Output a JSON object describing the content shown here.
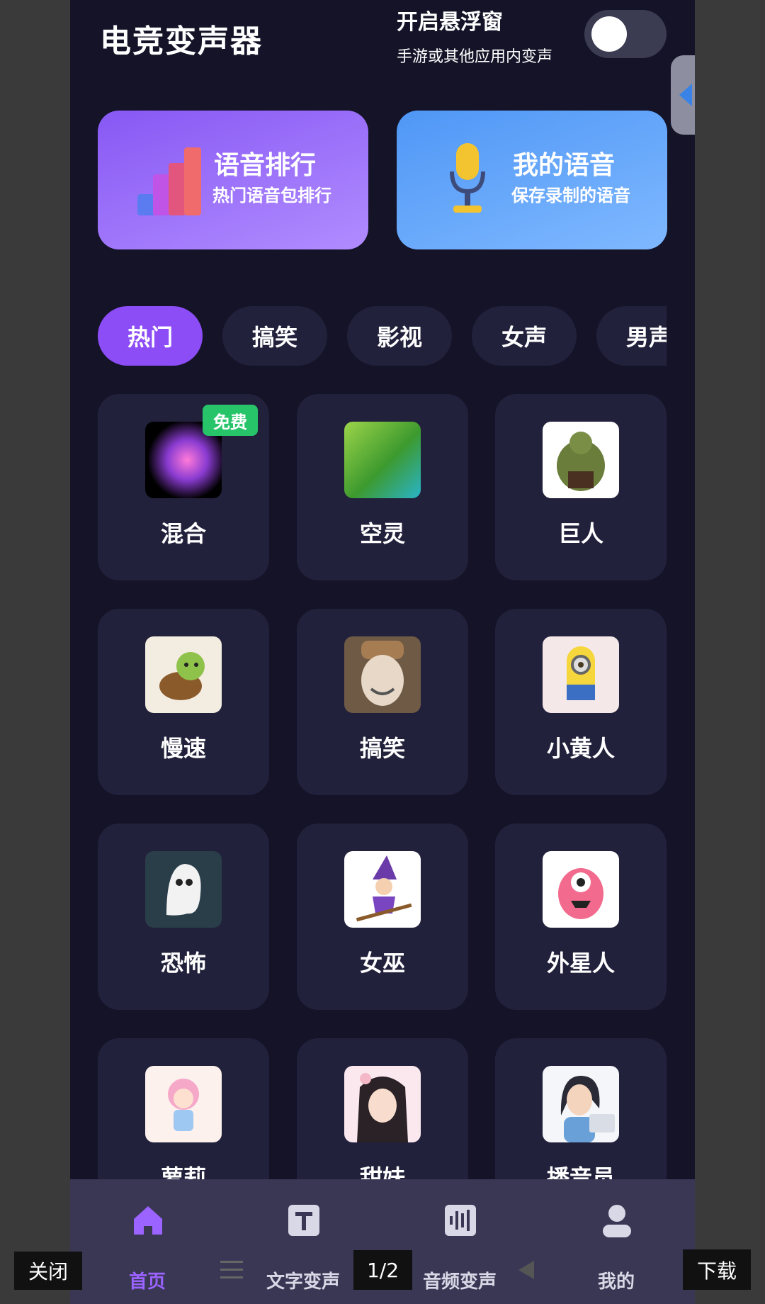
{
  "app": {
    "title": "电竞变声器"
  },
  "float_window": {
    "title": "开启悬浮窗",
    "subtitle": "手游或其他应用内变声",
    "enabled": false
  },
  "cards": [
    {
      "title": "语音排行",
      "subtitle": "热门语音包排行",
      "icon": "bar-chart-icon"
    },
    {
      "title": "我的语音",
      "subtitle": "保存录制的语音",
      "icon": "microphone-icon"
    }
  ],
  "tabs": [
    {
      "label": "热门",
      "active": true
    },
    {
      "label": "搞笑",
      "active": false
    },
    {
      "label": "影视",
      "active": false
    },
    {
      "label": "女声",
      "active": false
    },
    {
      "label": "男声",
      "active": false
    }
  ],
  "voices": [
    {
      "label": "混合",
      "badge": "免费",
      "thumb": "colorful-smoke"
    },
    {
      "label": "空灵",
      "thumb": "green-wave"
    },
    {
      "label": "巨人",
      "thumb": "ogre"
    },
    {
      "label": "慢速",
      "thumb": "turtle"
    },
    {
      "label": "搞笑",
      "thumb": "laughing-statue"
    },
    {
      "label": "小黄人",
      "thumb": "minion"
    },
    {
      "label": "恐怖",
      "thumb": "ghost"
    },
    {
      "label": "女巫",
      "thumb": "witch"
    },
    {
      "label": "外星人",
      "thumb": "pink-monster"
    },
    {
      "label": "萝莉",
      "thumb": "cute-girl"
    },
    {
      "label": "甜妹",
      "thumb": "sweet-girl"
    },
    {
      "label": "播音员",
      "thumb": "announcer"
    }
  ],
  "nav": [
    {
      "label": "首页",
      "icon": "home-icon",
      "active": true
    },
    {
      "label": "文字变声",
      "icon": "text-icon",
      "active": false
    },
    {
      "label": "音频变声",
      "icon": "audio-wave-icon",
      "active": false
    },
    {
      "label": "我的",
      "icon": "profile-icon",
      "active": false
    }
  ],
  "overlay": {
    "close": "关闭",
    "page": "1/2",
    "download": "下载"
  },
  "colors": {
    "accent": "#8c4df6",
    "background": "#141328",
    "card": "#22213c",
    "badge": "#27c46a"
  }
}
